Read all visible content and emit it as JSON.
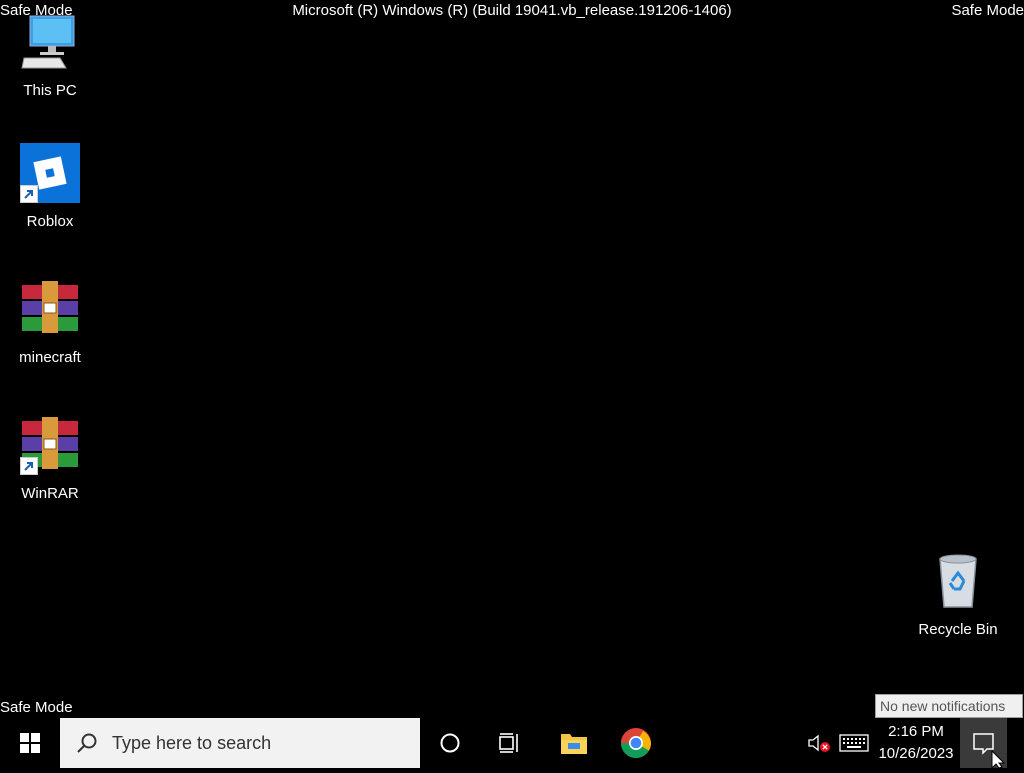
{
  "overlay": {
    "safe_mode": "Safe Mode",
    "build": "Microsoft (R) Windows (R) (Build 19041.vb_release.191206-1406)"
  },
  "desktop": {
    "icons": [
      {
        "label": "This PC",
        "icon": "computer-icon"
      },
      {
        "label": "Roblox",
        "icon": "roblox-icon",
        "shortcut": true
      },
      {
        "label": "minecraft",
        "icon": "winrar-archive-icon"
      },
      {
        "label": "WinRAR",
        "icon": "winrar-icon",
        "shortcut": true
      },
      {
        "label": "Recycle Bin",
        "icon": "recycle-bin-icon"
      }
    ]
  },
  "taskbar": {
    "search_placeholder": "Type here to search",
    "pinned": [
      "cortana-icon",
      "task-view-icon",
      "file-explorer-icon",
      "chrome-icon"
    ],
    "tray": [
      "speaker-muted-icon",
      "keyboard-icon"
    ],
    "time": "2:16 PM",
    "date": "10/26/2023",
    "tooltip": "No new notifications"
  },
  "colors": {
    "desktop": "#000000",
    "search_bg": "#f2f2f2",
    "roblox_bg": "#0a72d8",
    "action_center_active": "#3a3a3a"
  }
}
